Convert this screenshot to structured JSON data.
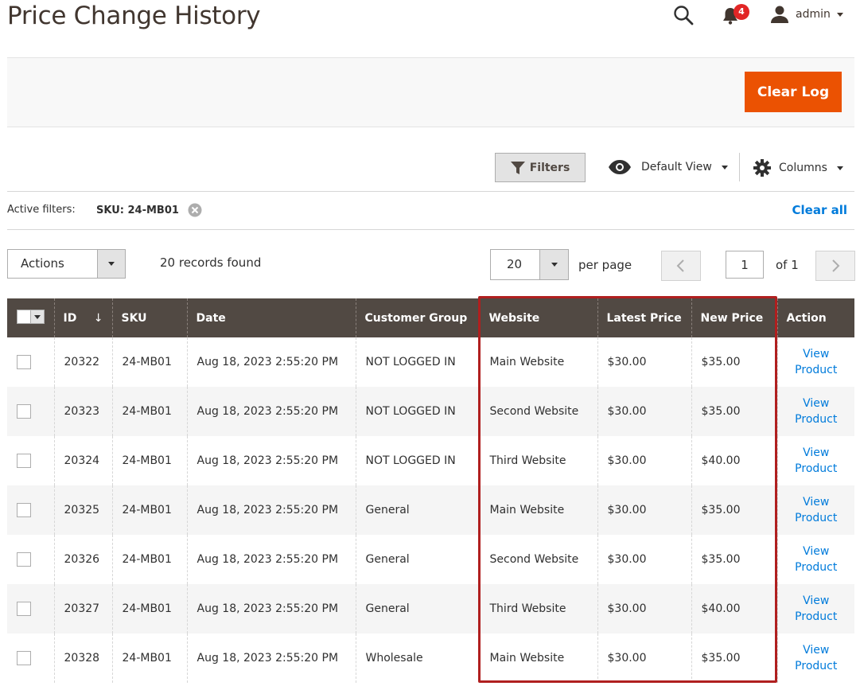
{
  "header": {
    "title": "Price Change History",
    "notification_count": "4",
    "user_name": "admin"
  },
  "page_actions": {
    "clear_log_label": "Clear Log"
  },
  "toolbar": {
    "filters_label": "Filters",
    "view_label": "Default View",
    "columns_label": "Columns"
  },
  "active_filters": {
    "label": "Active filters:",
    "chip": "SKU: 24-MB01",
    "clear_all": "Clear all"
  },
  "grid_controls": {
    "actions_label": "Actions",
    "records_found": "20 records found",
    "per_page_value": "20",
    "per_page_label": "per page",
    "current_page": "1",
    "page_of": "of 1"
  },
  "table": {
    "sort_indicator": "↓",
    "columns": [
      "ID",
      "SKU",
      "Date",
      "Customer Group",
      "Website",
      "Latest Price",
      "New Price",
      "Action"
    ],
    "rows": [
      {
        "id": "20322",
        "sku": "24-MB01",
        "date": "Aug 18, 2023 2:55:20 PM",
        "group": "NOT LOGGED IN",
        "website": "Main Website",
        "latest": "$30.00",
        "new": "$35.00",
        "action": "View Product"
      },
      {
        "id": "20323",
        "sku": "24-MB01",
        "date": "Aug 18, 2023 2:55:20 PM",
        "group": "NOT LOGGED IN",
        "website": "Second Website",
        "latest": "$30.00",
        "new": "$35.00",
        "action": "View Product"
      },
      {
        "id": "20324",
        "sku": "24-MB01",
        "date": "Aug 18, 2023 2:55:20 PM",
        "group": "NOT LOGGED IN",
        "website": "Third Website",
        "latest": "$30.00",
        "new": "$40.00",
        "action": "View Product"
      },
      {
        "id": "20325",
        "sku": "24-MB01",
        "date": "Aug 18, 2023 2:55:20 PM",
        "group": "General",
        "website": "Main Website",
        "latest": "$30.00",
        "new": "$35.00",
        "action": "View Product"
      },
      {
        "id": "20326",
        "sku": "24-MB01",
        "date": "Aug 18, 2023 2:55:20 PM",
        "group": "General",
        "website": "Second Website",
        "latest": "$30.00",
        "new": "$35.00",
        "action": "View Product"
      },
      {
        "id": "20327",
        "sku": "24-MB01",
        "date": "Aug 18, 2023 2:55:20 PM",
        "group": "General",
        "website": "Third Website",
        "latest": "$30.00",
        "new": "$40.00",
        "action": "View Product"
      },
      {
        "id": "20328",
        "sku": "24-MB01",
        "date": "Aug 18, 2023 2:55:20 PM",
        "group": "Wholesale",
        "website": "Main Website",
        "latest": "$30.00",
        "new": "$35.00",
        "action": "View Product"
      }
    ]
  },
  "colors": {
    "accent": "#eb5202",
    "header_bg": "#514943",
    "link": "#007bdb",
    "highlight": "#b01f1f",
    "badge": "#e22626"
  },
  "icons": [
    "search-icon",
    "bell-icon",
    "user-icon",
    "filter-icon",
    "eye-icon",
    "gear-icon",
    "remove-icon",
    "chevron-left-icon",
    "chevron-right-icon"
  ]
}
